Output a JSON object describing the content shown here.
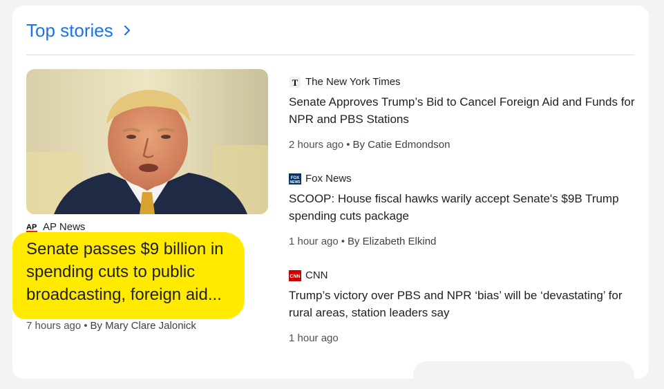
{
  "section": {
    "title": "Top stories"
  },
  "featured": {
    "source": "AP News",
    "logo_text": "AP",
    "title": "Senate passes $9 billion in spending cuts to public broadcasting, foreign aid...",
    "time": "7 hours ago",
    "byline": "By Mary Clare Jalonick",
    "highlight_color": "#ffea00"
  },
  "stories": [
    {
      "source": "The New York Times",
      "logo_icon": "nyt-logo-icon",
      "title": "Senate Approves Trump’s Bid to Cancel Foreign Aid and Funds for NPR and PBS Stations",
      "time": "2 hours ago",
      "byline": "By Catie Edmondson"
    },
    {
      "source": "Fox News",
      "logo_icon": "fox-news-logo-icon",
      "title": "SCOOP: House fiscal hawks warily accept Senate's $9B Trump spending cuts package",
      "time": "1 hour ago",
      "byline": "By Elizabeth Elkind"
    },
    {
      "source": "CNN",
      "logo_icon": "cnn-logo-icon",
      "title": "Trump’s victory over PBS and NPR ‘bias’ will be ‘devastating’ for rural areas, station leaders say",
      "time": "1 hour ago"
    }
  ],
  "colors": {
    "link_blue": "#1a73e8",
    "highlight": "#ffea00",
    "cnn_red": "#cc0000",
    "fox_blue": "#003366"
  }
}
